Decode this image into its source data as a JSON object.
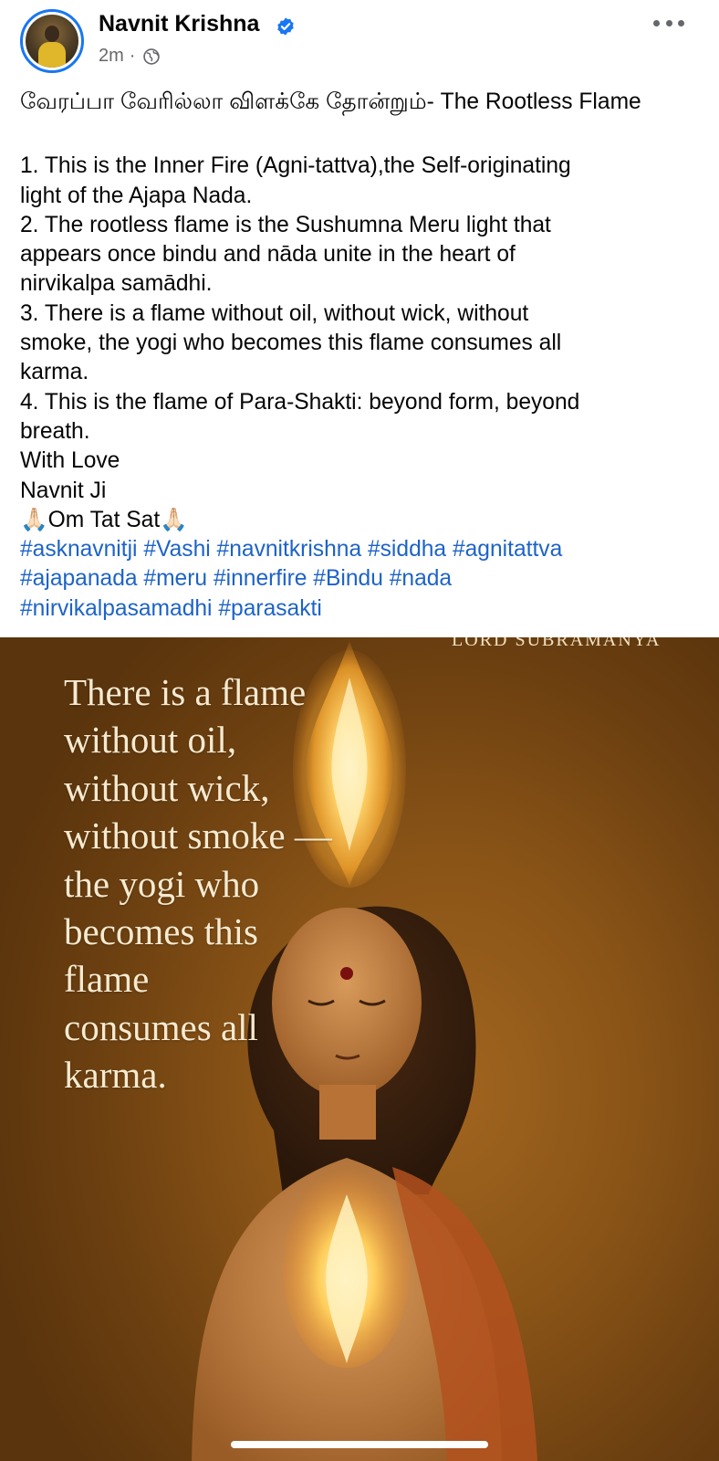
{
  "post": {
    "author": "Navnit Krishna",
    "timestamp": "2m",
    "separator": "·",
    "audience_icon": "globe-icon",
    "more_icon": "more-options-icon",
    "text_lines": [
      "வேரப்பா வேரில்லா விளக்கே தோன்றும்- The Rootless Flame",
      "",
      "1. This is the Inner Fire (Agni-tattva),the Self-originating",
      "light of the Ajapa Nada.",
      "2. The rootless flame is the Sushumna Meru light that",
      "appears once bindu and nāda unite in the heart of",
      "nirvikalpa samādhi.",
      "3. There is a flame without oil, without wick, without",
      "smoke, the yogi who becomes this flame consumes all",
      "karma.",
      "4. This is the flame of Para-Shakti: beyond form, beyond",
      "breath.",
      "With Love",
      "Navnit Ji",
      "🙏🏻Om Tat Sat🙏🏻"
    ],
    "hashtag_lines": [
      "#asknavnitji #Vashi #navnitkrishna #siddha #agnitattva",
      "#ajapanada #meru #innerfire #Bindu #nada",
      "#nirvikalpasamadhi #parasakti"
    ]
  },
  "image": {
    "top_label": "LORD SUBRAMANYA",
    "caption_lines": [
      "There is a flame",
      "without oil,",
      "without wick,",
      "without smoke —",
      "the yogi who",
      "becomes this",
      "flame",
      "consumes all",
      "karma."
    ]
  },
  "colors": {
    "link": "#1d63c7",
    "verified": "#1877f2",
    "meta": "#65676b"
  }
}
